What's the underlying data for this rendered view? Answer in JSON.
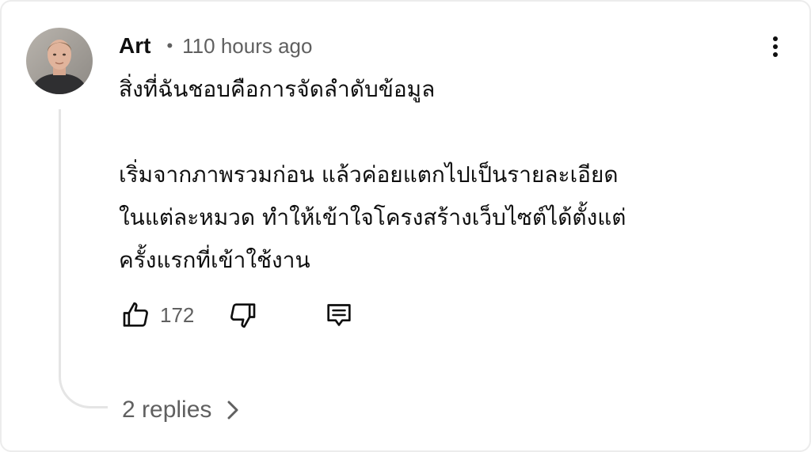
{
  "comment": {
    "author": "Art",
    "separator": "•",
    "timestamp": "110 hours ago",
    "paragraphs": [
      "สิ่งที่ฉันชอบคือการจัดลำดับข้อมูล",
      "เริ่มจากภาพรวมก่อน แล้วค่อยแตกไปเป็นรายละเอียด",
      "ในแต่ละหมวด ทำให้เข้าใจโครงสร้างเว็บไซต์ได้ตั้งแต่",
      "ครั้งแรกที่เข้าใช้งาน"
    ],
    "like_count": "172",
    "replies_label": "2 replies"
  },
  "icons": {
    "avatar": "avatar",
    "more": "more-vert-icon",
    "like": "thumb-up-icon",
    "dislike": "thumb-down-icon",
    "reply": "comment-reply-icon",
    "expand": "chevron-right-icon"
  },
  "colors": {
    "text": "#0f0f0f",
    "secondary": "#606060",
    "thread_line": "#e5e5e5",
    "border": "#ececec"
  }
}
